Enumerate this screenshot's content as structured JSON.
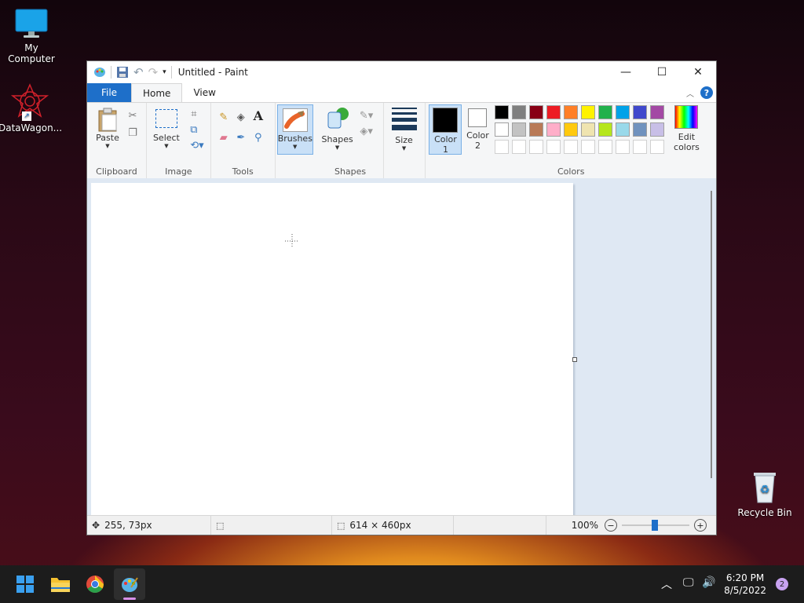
{
  "desktop": {
    "icons": [
      {
        "label": "My Computer"
      },
      {
        "label": "DataWagon..."
      },
      {
        "label": "Recycle Bin"
      }
    ]
  },
  "window": {
    "title": "Untitled - Paint",
    "tabs": {
      "file": "File",
      "home": "Home",
      "view": "View"
    },
    "ribbon": {
      "clipboard": {
        "group": "Clipboard",
        "paste": "Paste"
      },
      "image": {
        "group": "Image",
        "select": "Select"
      },
      "tools": {
        "group": "Tools"
      },
      "brushes": {
        "label": "Brushes"
      },
      "shapes": {
        "group": "Shapes",
        "label": "Shapes"
      },
      "size": {
        "label": "Size"
      },
      "color1": {
        "line1": "Color",
        "line2": "1"
      },
      "color2": {
        "line1": "Color",
        "line2": "2"
      },
      "colors": {
        "group": "Colors",
        "edit_line1": "Edit",
        "edit_line2": "colors"
      }
    },
    "palette_row1": [
      "#000000",
      "#7f7f7f",
      "#880015",
      "#ed1c24",
      "#ff7f27",
      "#fff200",
      "#22b14c",
      "#00a2e8",
      "#3f48cc",
      "#a349a4"
    ],
    "palette_row2": [
      "#ffffff",
      "#c3c3c3",
      "#b97a57",
      "#ffaec9",
      "#ffc90e",
      "#efe4b0",
      "#b5e61d",
      "#99d9ea",
      "#7092be",
      "#c8bfe7"
    ],
    "status": {
      "cursor_pos": "255, 73px",
      "canvas_size": "614 × 460px",
      "zoom": "100%"
    }
  },
  "taskbar": {
    "time": "6:20 PM",
    "date": "8/5/2022",
    "notifications": "2"
  }
}
